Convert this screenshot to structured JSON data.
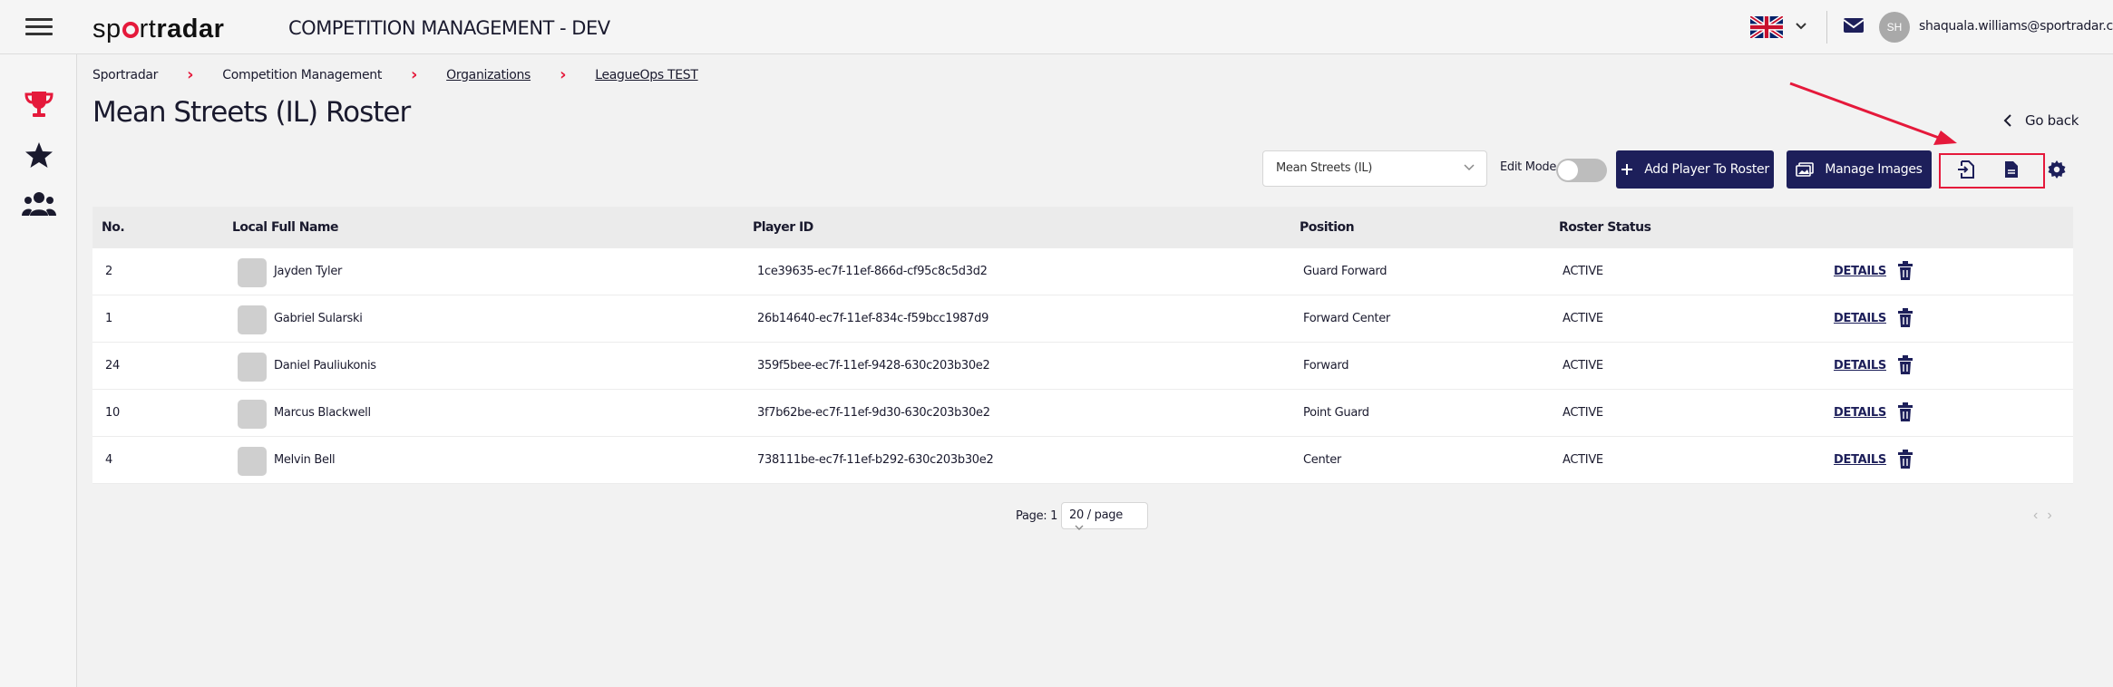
{
  "header": {
    "logo_text_a": "sp",
    "logo_text_b": "rt",
    "logo_text_c": "radar",
    "app_title": "COMPETITION MANAGEMENT - DEV",
    "avatar_initials": "SH",
    "user_email": "shaquala.williams@sportradar.com"
  },
  "breadcrumb": [
    "Sportradar",
    "Competition Management",
    "Organizations",
    "LeagueOps TEST"
  ],
  "page": {
    "title": "Mean Streets (IL) Roster",
    "go_back": "Go back"
  },
  "toolbar": {
    "team_select": "Mean Streets (IL)",
    "edit_mode_label": "Edit Mode",
    "edit_mode_on": false,
    "add_player_label": "Add Player To Roster",
    "manage_images_label": "Manage Images"
  },
  "table": {
    "headers": [
      "No.",
      "Local Full Name",
      "Player ID",
      "Position",
      "Roster Status"
    ],
    "rows": [
      {
        "no": "2",
        "name": "Jayden Tyler",
        "player_id": "1ce39635-ec7f-11ef-866d-cf95c8c5d3d2",
        "position": "Guard Forward",
        "status": "ACTIVE",
        "action": "DETAILS"
      },
      {
        "no": "1",
        "name": "Gabriel Sularski",
        "player_id": "26b14640-ec7f-11ef-834c-f59bcc1987d9",
        "position": "Forward Center",
        "status": "ACTIVE",
        "action": "DETAILS"
      },
      {
        "no": "24",
        "name": "Daniel Pauliukonis",
        "player_id": "359f5bee-ec7f-11ef-9428-630c203b30e2",
        "position": "Forward",
        "status": "ACTIVE",
        "action": "DETAILS"
      },
      {
        "no": "10",
        "name": "Marcus Blackwell",
        "player_id": "3f7b62be-ec7f-11ef-9d30-630c203b30e2",
        "position": "Point Guard",
        "status": "ACTIVE",
        "action": "DETAILS"
      },
      {
        "no": "4",
        "name": "Melvin Bell",
        "player_id": "738111be-ec7f-11ef-b292-630c203b30e2",
        "position": "Center",
        "status": "ACTIVE",
        "action": "DETAILS"
      }
    ]
  },
  "pagination": {
    "page_label": "Page: 1",
    "page_size": "20 / page"
  },
  "colors": {
    "brand_red": "#e5193b",
    "primary_navy": "#1d1f5a"
  }
}
